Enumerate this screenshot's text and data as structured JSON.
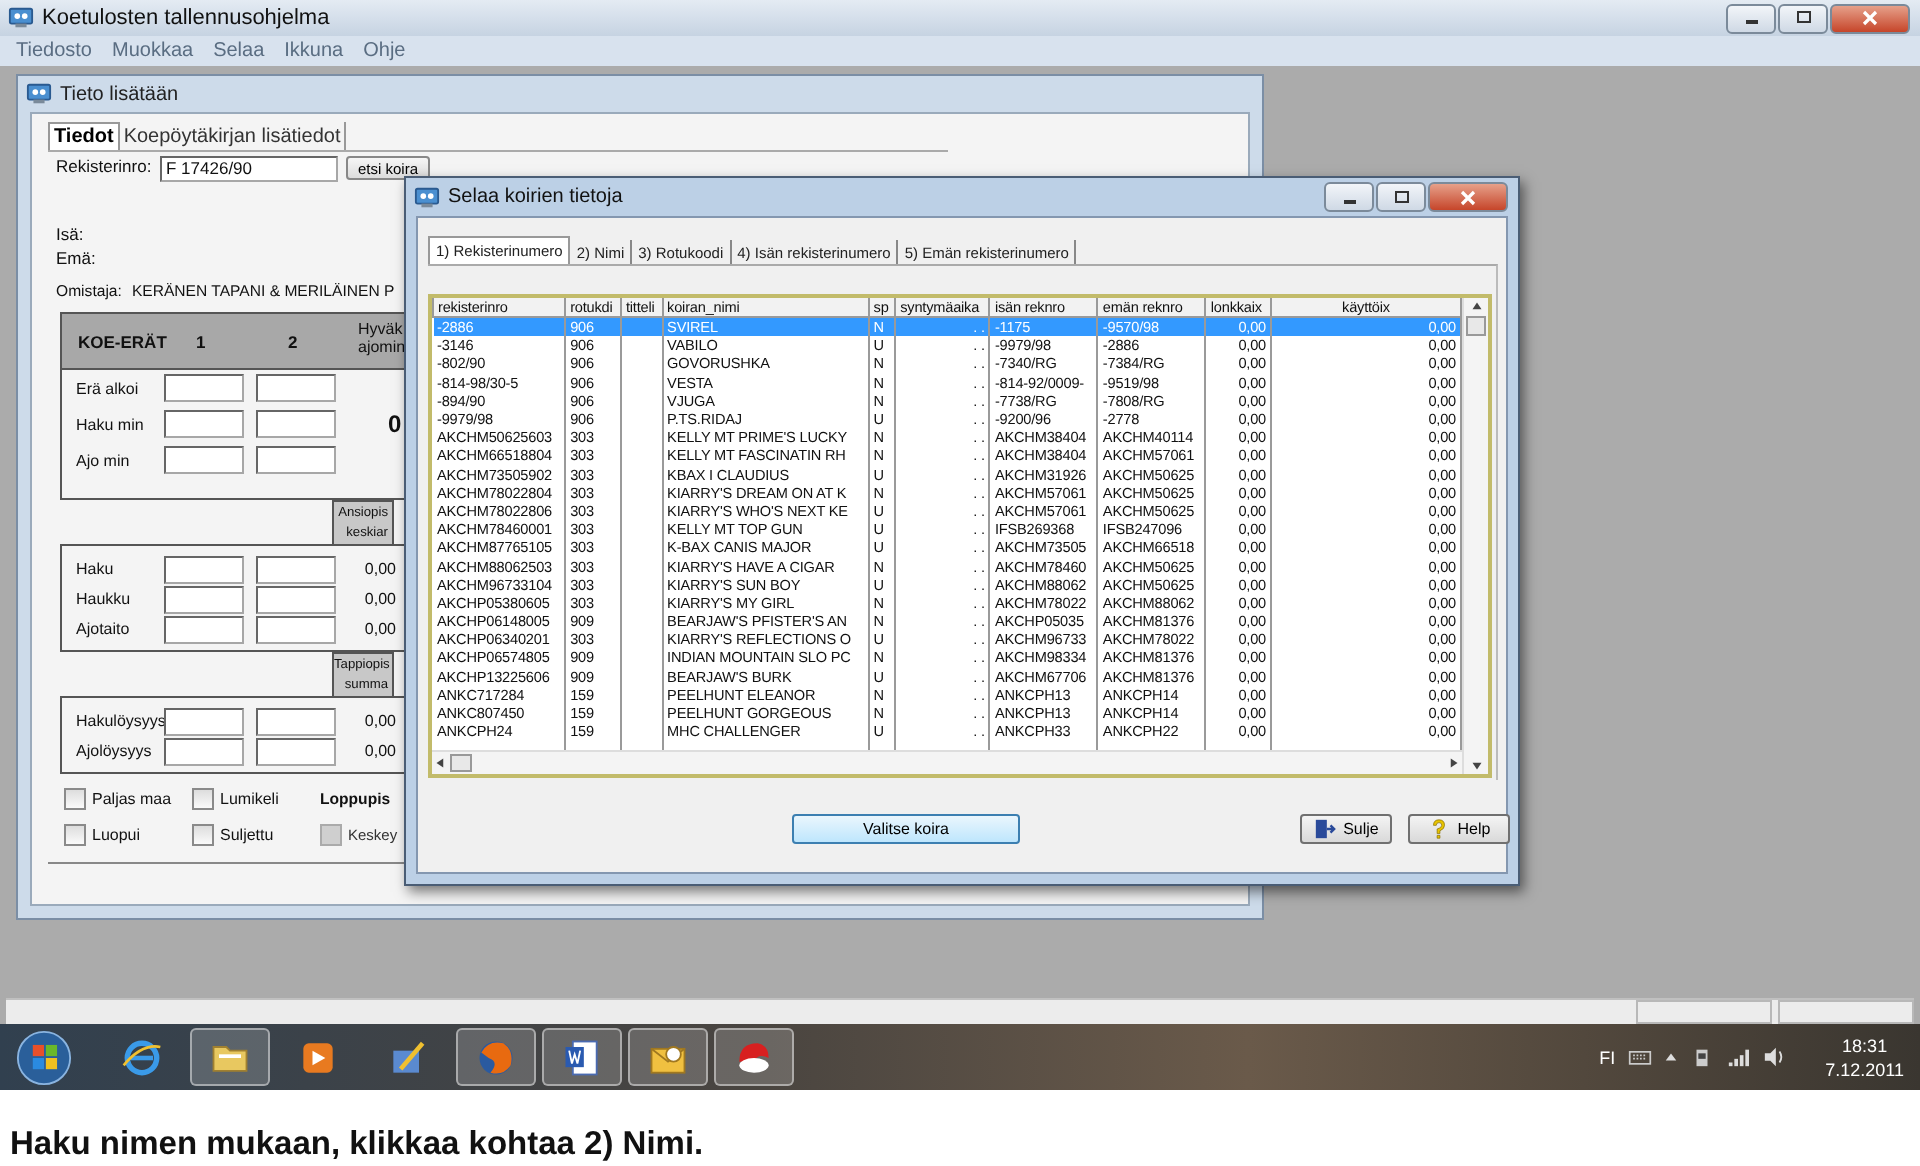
{
  "window": {
    "title": "Koetulosten tallennusohjelma"
  },
  "menu": [
    "Tiedosto",
    "Muokkaa",
    "Selaa",
    "Ikkuna",
    "Ohje"
  ],
  "form_window": {
    "title": "Tieto lisätään",
    "tabs": [
      {
        "label": "Tiedot",
        "selected": true
      },
      {
        "label": "Koepöytäkirjan lisätiedot",
        "selected": false
      }
    ],
    "registration": {
      "label": "Rekisterinro:",
      "value": "F 17426/90",
      "button": "etsi koira"
    },
    "sire_label": "Isä:",
    "dam_label": "Emä:",
    "owner": {
      "label": "Omistaja:",
      "value": "KERÄNEN TAPANI & MERILÄINEN P"
    },
    "rounds": {
      "header": [
        "KOE-ERÄT",
        "1",
        "2"
      ],
      "header_cut": [
        "Hyväk",
        "ajomin"
      ],
      "rows": [
        {
          "label": "Erä alkoi"
        },
        {
          "label": "Haku min",
          "value": "0"
        },
        {
          "label": "Ajo min"
        }
      ]
    },
    "merit": {
      "header": [
        "Ansiopis",
        "keskiar"
      ],
      "rows": [
        {
          "label": "Haku",
          "value": "0,00"
        },
        {
          "label": "Haukku",
          "value": "0,00"
        },
        {
          "label": "Ajotaito",
          "value": "0,00"
        }
      ]
    },
    "penalty": {
      "header": [
        "Tappiopis",
        "summa"
      ],
      "rows": [
        {
          "label": "Hakulöysyys",
          "value": "0,00"
        },
        {
          "label": "Ajolöysyys",
          "value": "0,00"
        }
      ]
    },
    "options": [
      {
        "kind": "checkbox",
        "label": "Paljas maa",
        "checked": false,
        "disabled": false
      },
      {
        "kind": "checkbox",
        "label": "Lumikeli",
        "checked": false,
        "disabled": false
      },
      {
        "kind": "label",
        "label": "Loppupis"
      },
      {
        "kind": "checkbox",
        "label": "Luopui",
        "checked": false,
        "disabled": false
      },
      {
        "kind": "checkbox",
        "label": "Suljettu",
        "checked": false,
        "disabled": false
      },
      {
        "kind": "checkbox",
        "label": "Keskey",
        "checked": false,
        "disabled": true
      }
    ]
  },
  "dialog": {
    "title": "Selaa koirien tietoja",
    "tabs": [
      {
        "label": "1) Rekisterinumero",
        "selected": true
      },
      {
        "label": "2) Nimi",
        "selected": false
      },
      {
        "label": "3) Rotukoodi",
        "selected": false
      },
      {
        "label": "4) Isän rekisterinumero",
        "selected": false
      },
      {
        "label": "5) Emän rekisterinumero",
        "selected": false
      }
    ],
    "columns": [
      {
        "label": "rekisterinro",
        "kind": "text"
      },
      {
        "label": "rotukdi",
        "kind": "text"
      },
      {
        "label": "titteli",
        "kind": "text"
      },
      {
        "label": "koiran_nimi",
        "kind": "text"
      },
      {
        "label": "sp",
        "kind": "text"
      },
      {
        "label": "syntymäaika",
        "kind": "date"
      },
      {
        "label": "isän reknro",
        "kind": "text"
      },
      {
        "label": "emän reknro",
        "kind": "text"
      },
      {
        "label": "lonkkaix",
        "kind": "number"
      },
      {
        "label": "käyttöix",
        "kind": "number"
      }
    ],
    "rows": [
      {
        "selected": true,
        "cells": [
          "-2886",
          "906",
          "",
          "SVIREL",
          "N",
          ". .",
          "-1175",
          "-9570/98",
          "0,00",
          "0,00"
        ]
      },
      {
        "selected": false,
        "cells": [
          "-3146",
          "906",
          "",
          "VABILO",
          "U",
          ". .",
          "-9979/98",
          "-2886",
          "0,00",
          "0,00"
        ]
      },
      {
        "selected": false,
        "cells": [
          "-802/90",
          "906",
          "",
          "GOVORUSHKA",
          "N",
          ". .",
          "-7340/RG",
          "-7384/RG",
          "0,00",
          "0,00"
        ]
      },
      {
        "selected": false,
        "cells": [
          "-814-98/30-5",
          "906",
          "",
          "VESTA",
          "N",
          ". .",
          "-814-92/0009-",
          "-9519/98",
          "0,00",
          "0,00"
        ]
      },
      {
        "selected": false,
        "cells": [
          "-894/90",
          "906",
          "",
          "VJUGA",
          "N",
          ". .",
          "-7738/RG",
          "-7808/RG",
          "0,00",
          "0,00"
        ]
      },
      {
        "selected": false,
        "cells": [
          "-9979/98",
          "906",
          "",
          "P.TS.RIDAJ",
          "U",
          ". .",
          "-9200/96",
          "-2778",
          "0,00",
          "0,00"
        ]
      },
      {
        "selected": false,
        "cells": [
          "AKCHM50625603",
          "303",
          "",
          "KELLY MT PRIME'S LUCKY",
          "N",
          ". .",
          "AKCHM38404",
          "AKCHM40114",
          "0,00",
          "0,00"
        ]
      },
      {
        "selected": false,
        "cells": [
          "AKCHM66518804",
          "303",
          "",
          "KELLY MT FASCINATIN RH",
          "N",
          ". .",
          "AKCHM38404",
          "AKCHM57061",
          "0,00",
          "0,00"
        ]
      },
      {
        "selected": false,
        "cells": [
          "AKCHM73505902",
          "303",
          "",
          "KBAX I CLAUDIUS",
          "U",
          ". .",
          "AKCHM31926",
          "AKCHM50625",
          "0,00",
          "0,00"
        ]
      },
      {
        "selected": false,
        "cells": [
          "AKCHM78022804",
          "303",
          "",
          "KIARRY'S DREAM ON AT K",
          "N",
          ". .",
          "AKCHM57061",
          "AKCHM50625",
          "0,00",
          "0,00"
        ]
      },
      {
        "selected": false,
        "cells": [
          "AKCHM78022806",
          "303",
          "",
          "KIARRY'S WHO'S NEXT KE",
          "U",
          ". .",
          "AKCHM57061",
          "AKCHM50625",
          "0,00",
          "0,00"
        ]
      },
      {
        "selected": false,
        "cells": [
          "AKCHM78460001",
          "303",
          "",
          "KELLY MT TOP GUN",
          "U",
          ". .",
          "IFSB269368",
          "IFSB247096",
          "0,00",
          "0,00"
        ]
      },
      {
        "selected": false,
        "cells": [
          "AKCHM87765105",
          "303",
          "",
          "K-BAX CANIS MAJOR",
          "U",
          ". .",
          "AKCHM73505",
          "AKCHM66518",
          "0,00",
          "0,00"
        ]
      },
      {
        "selected": false,
        "cells": [
          "AKCHM88062503",
          "303",
          "",
          "KIARRY'S HAVE A CIGAR",
          "N",
          ". .",
          "AKCHM78460",
          "AKCHM50625",
          "0,00",
          "0,00"
        ]
      },
      {
        "selected": false,
        "cells": [
          "AKCHM96733104",
          "303",
          "",
          "KIARRY'S SUN BOY",
          "U",
          ". .",
          "AKCHM88062",
          "AKCHM50625",
          "0,00",
          "0,00"
        ]
      },
      {
        "selected": false,
        "cells": [
          "AKCHP05380605",
          "303",
          "",
          "KIARRY'S MY GIRL",
          "N",
          ". .",
          "AKCHM78022",
          "AKCHM88062",
          "0,00",
          "0,00"
        ]
      },
      {
        "selected": false,
        "cells": [
          "AKCHP06148005",
          "909",
          "",
          "BEARJAW'S PFISTER'S AN",
          "N",
          ". .",
          "AKCHP05035",
          "AKCHM81376",
          "0,00",
          "0,00"
        ]
      },
      {
        "selected": false,
        "cells": [
          "AKCHP06340201",
          "303",
          "",
          "KIARRY'S REFLECTIONS O",
          "U",
          ". .",
          "AKCHM96733",
          "AKCHM78022",
          "0,00",
          "0,00"
        ]
      },
      {
        "selected": false,
        "cells": [
          "AKCHP06574805",
          "909",
          "",
          "INDIAN MOUNTAIN SLO PC",
          "N",
          ". .",
          "AKCHM98334",
          "AKCHM81376",
          "0,00",
          "0,00"
        ]
      },
      {
        "selected": false,
        "cells": [
          "AKCHP13225606",
          "909",
          "",
          "BEARJAW'S BURK",
          "U",
          ". .",
          "AKCHM67706",
          "AKCHM81376",
          "0,00",
          "0,00"
        ]
      },
      {
        "selected": false,
        "cells": [
          "ANKC717284",
          "159",
          "",
          "PEELHUNT ELEANOR",
          "N",
          ". .",
          "ANKCPH13",
          "ANKCPH14",
          "0,00",
          "0,00"
        ]
      },
      {
        "selected": false,
        "cells": [
          "ANKC807450",
          "159",
          "",
          "PEELHUNT GORGEOUS",
          "N",
          ". .",
          "ANKCPH13",
          "ANKCPH14",
          "0,00",
          "0,00"
        ]
      },
      {
        "selected": false,
        "cells": [
          "ANKCPH24",
          "159",
          "",
          "MHC CHALLENGER",
          "U",
          ". .",
          "ANKCPH33",
          "ANKCPH22",
          "0,00",
          "0,00"
        ]
      }
    ],
    "buttons": [
      {
        "label": "Valitse koira",
        "kind": "default"
      },
      {
        "label": "Sulje",
        "kind": "close"
      },
      {
        "label": "Help",
        "kind": "help"
      }
    ]
  },
  "taskbar": {
    "language": "FI",
    "time": "18:31",
    "date": "7.12.2011"
  },
  "caption": "Haku nimen mukaan, klikkaa kohtaa 2) Nimi."
}
